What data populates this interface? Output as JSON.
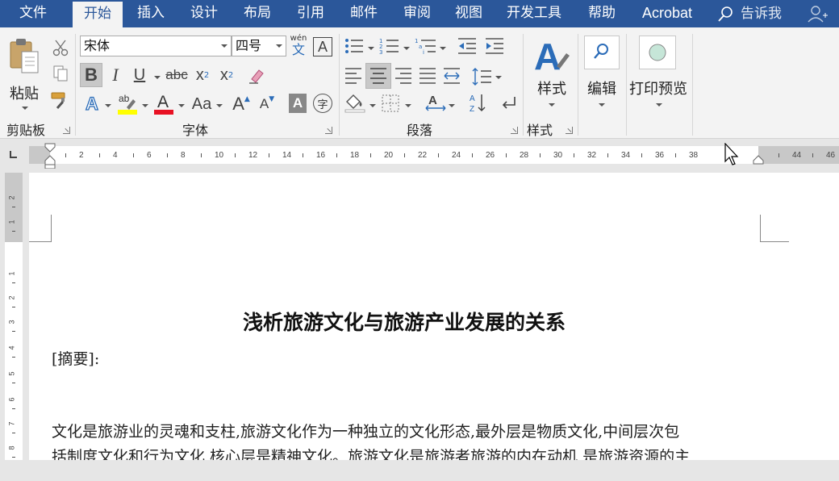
{
  "tabs": [
    "文件",
    "开始",
    "插入",
    "设计",
    "布局",
    "引用",
    "邮件",
    "审阅",
    "视图",
    "开发工具",
    "帮助",
    "Acrobat"
  ],
  "active_tab": "开始",
  "tell_me": "告诉我",
  "clipboard": {
    "paste_label": "粘贴",
    "group_label": "剪贴板"
  },
  "font": {
    "name": "宋体",
    "size": "四号",
    "group_label": "字体",
    "wen_label": "wén",
    "wen_char": "文",
    "bold": "B",
    "italic": "I",
    "underline": "U",
    "strike": "abc",
    "sub": "x",
    "sub_mark": "2",
    "sup": "x",
    "sup_mark": "2",
    "border_a": "A",
    "grow_a": "A",
    "shrink_a": "A",
    "case_label": "Aa",
    "shade_a": "A",
    "enclose": "字",
    "highlight_color": "#ffff00",
    "font_color": "#e81123"
  },
  "paragraph": {
    "group_label": "段落"
  },
  "styles": {
    "label": "样式",
    "group_label": "样式"
  },
  "editing": {
    "label": "编辑"
  },
  "print_preview": {
    "label": "打印预览"
  },
  "ruler": {
    "h_labels": [
      "2",
      "4",
      "6",
      "8",
      "10",
      "12",
      "14",
      "16",
      "18",
      "20",
      "22",
      "24",
      "26",
      "28",
      "30",
      "32",
      "34",
      "36",
      "38",
      "44",
      "46"
    ],
    "v_labels": [
      "2",
      "1",
      "1",
      "2",
      "3",
      "4",
      "5",
      "6",
      "7",
      "8"
    ]
  },
  "document": {
    "title": "浅析旅游文化与旅游产业发展的关系",
    "abstract_label": "[摘要]:",
    "body_line1": "文化是旅游业的灵魂和支柱,旅游文化作为一种独立的文化形态,最外层是物质文化,中间层次包",
    "body_line2": "括制度文化和行为文化,核心层是精神文化。旅游文化是旅游者旅游的内在动机,是旅游资源的主"
  },
  "colors": {
    "tabbar": "#2b579a",
    "ribbon": "#f3f3f3",
    "accent": "#2b579a"
  }
}
